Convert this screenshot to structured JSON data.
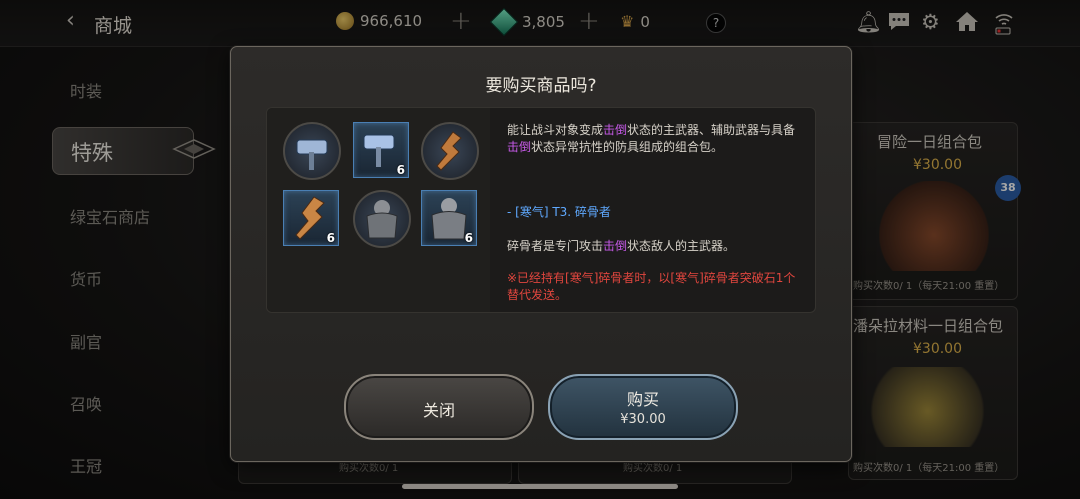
{
  "topbar": {
    "back_icon": "chevron-left",
    "title": "商城",
    "gold": "966,610",
    "gems": "3,805",
    "crowns": "0",
    "help": "?"
  },
  "sidebar": {
    "items": [
      {
        "label": "时装"
      },
      {
        "label": "特殊",
        "active": true
      },
      {
        "label": "绿宝石商店"
      },
      {
        "label": "货币"
      },
      {
        "label": "副官"
      },
      {
        "label": "召唤"
      },
      {
        "label": "王冠"
      }
    ]
  },
  "background_cards": {
    "card1": {
      "title": "冒险一日组合包",
      "price": "¥30.00",
      "limit": "购买次数0/ 1（每天21:00 重置）",
      "badge": "38"
    },
    "card2": {
      "title": "潘朵拉材料一日组合包",
      "price": "¥30.00",
      "limit": "购买次数0/ 1（每天21:00 重置）"
    },
    "card3": {
      "limit": "购买次数0/ 1"
    },
    "card4": {
      "limit": "购买次数0/ 1"
    }
  },
  "modal": {
    "title": "要购买商品吗?",
    "items": [
      {
        "icon": "hammer-icon",
        "qty": ""
      },
      {
        "icon": "hammer-icon",
        "qty": "6"
      },
      {
        "icon": "axe-icon",
        "qty": ""
      },
      {
        "icon": "axe-icon",
        "qty": "6"
      },
      {
        "icon": "armor-icon",
        "qty": ""
      },
      {
        "icon": "armor-icon",
        "qty": "6"
      }
    ],
    "desc1_a": "能让战斗对象变成",
    "desc1_kw": "击倒",
    "desc1_b": "状态的主武器、辅助武器与具备",
    "desc1_kw2": "击倒",
    "desc1_c": "状态异常抗性的防具组成的组合包。",
    "item_name": "- [寒气] T3. 碎骨者",
    "desc2_a": "碎骨者是专门攻击",
    "desc2_kw": "击倒",
    "desc2_b": "状态敌人的主武器。",
    "warning": "※已经持有[寒气]碎骨者时，以[寒气]碎骨者突破石1个替代发送。",
    "close_label": "关闭",
    "buy_label": "购买",
    "buy_price": "¥30.00"
  },
  "colors": {
    "accent_purple": "#c65ae8",
    "accent_blue": "#5fa9ff",
    "warning_red": "#e0463e",
    "price_gold": "#e2b54c"
  }
}
